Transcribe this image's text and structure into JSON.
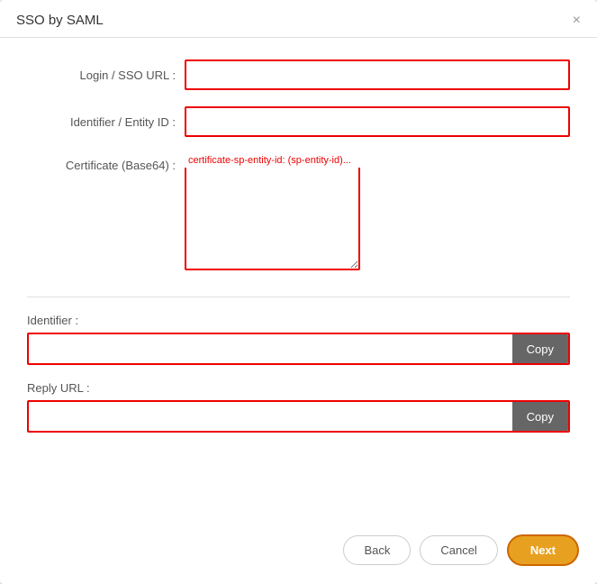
{
  "dialog": {
    "title": "SSO by SAML",
    "close_label": "×"
  },
  "form": {
    "login_url_label": "Login / SSO URL :",
    "entity_id_label": "Identifier / Entity ID :",
    "certificate_label": "Certificate (Base64) :",
    "certificate_hint": "certificate-sp-entity-id: (sp-entity-id)...",
    "identifier_label": "Identifier :",
    "identifier_value": "",
    "identifier_placeholder": "",
    "reply_url_label": "Reply URL :",
    "reply_url_value": "",
    "reply_url_placeholder": ""
  },
  "buttons": {
    "copy1_label": "Copy",
    "copy2_label": "Copy",
    "back_label": "Back",
    "cancel_label": "Cancel",
    "next_label": "Next"
  }
}
